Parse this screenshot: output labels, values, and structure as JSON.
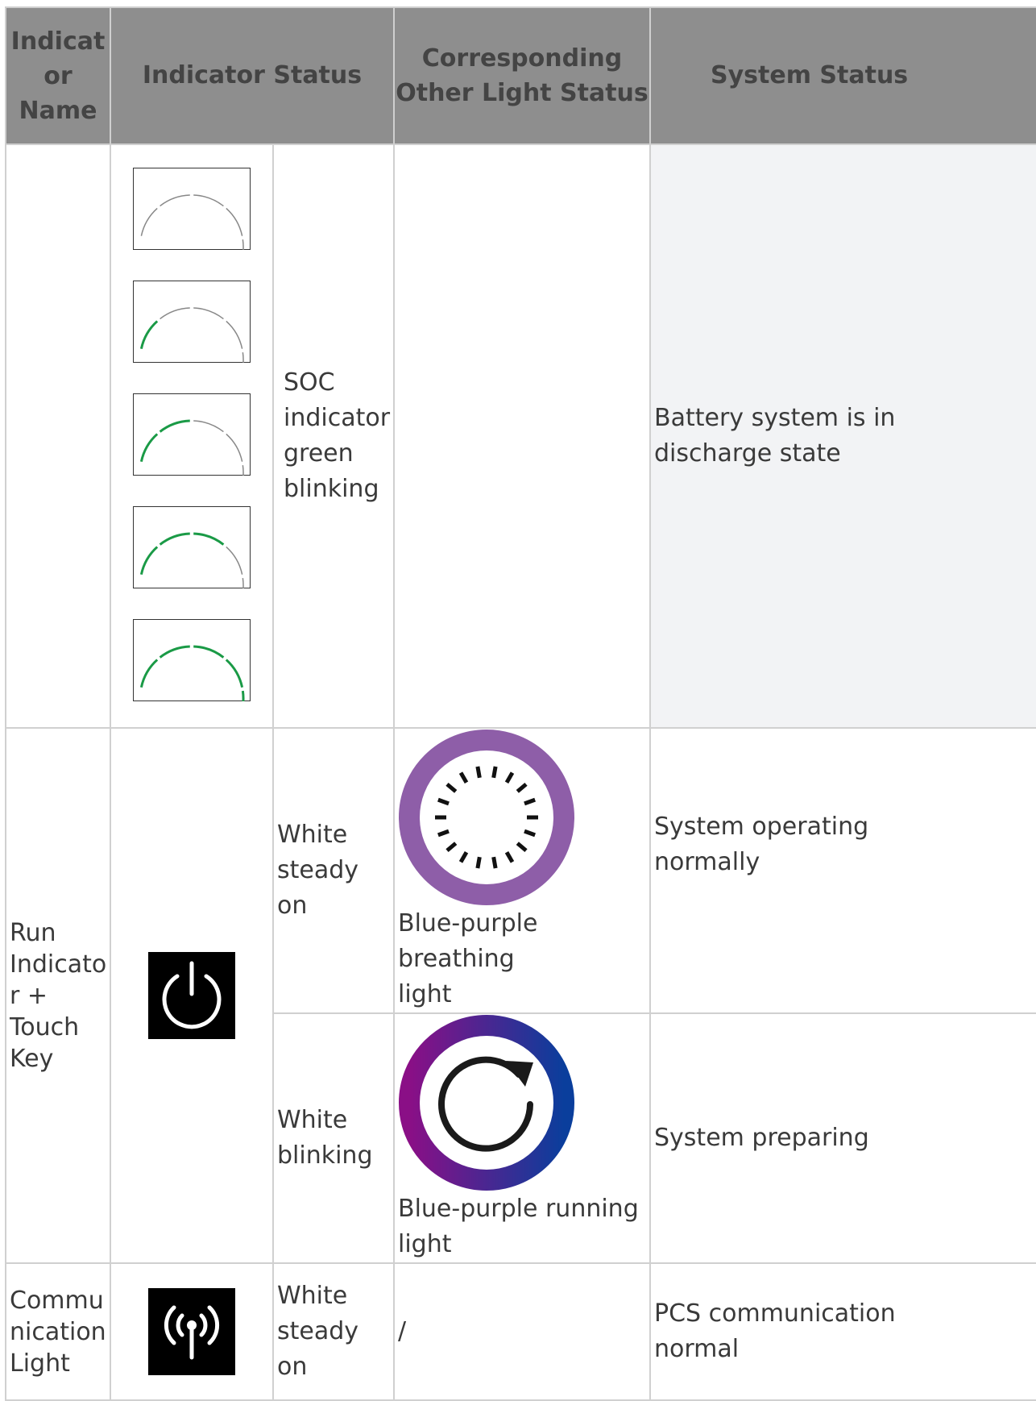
{
  "headers": {
    "name": "Indicat\nor\nName",
    "status": "Indicator Status",
    "other": "Corresponding\nOther Light Status",
    "system": "System Status"
  },
  "soc_row": {
    "name": "",
    "status_text": "SOC\nindicator\ngreen\nblinking",
    "other": "",
    "system": "Battery system is in\ndischarge state",
    "lit_segments": [
      0,
      1,
      2,
      3,
      4
    ]
  },
  "run_row": {
    "name": "Run\nIndicato\nr +\nTouch\nKey",
    "icon": "power-icon",
    "sub_rows": [
      {
        "status": "White\nsteady on",
        "other": "Blue-purple breathing\nlight",
        "other_icon": "breathing-light-icon",
        "system": "System operating\nnormally"
      },
      {
        "status": "White\nblinking",
        "other": "Blue-purple running\nlight",
        "other_icon": "running-light-icon",
        "system": "System preparing"
      }
    ]
  },
  "comm_row": {
    "name": "Commu\nnication\nLight",
    "icon": "antenna-icon",
    "status": "White\nsteady on",
    "other": "/",
    "system": "PCS communication\nnormal"
  },
  "colors": {
    "header_bg": "#8e8e8e",
    "soc_green": "#1a9a46",
    "soc_gray": "#888888",
    "purple": "#8e5ea8",
    "magenta": "#8a0f86",
    "blue": "#0a3e9c"
  }
}
